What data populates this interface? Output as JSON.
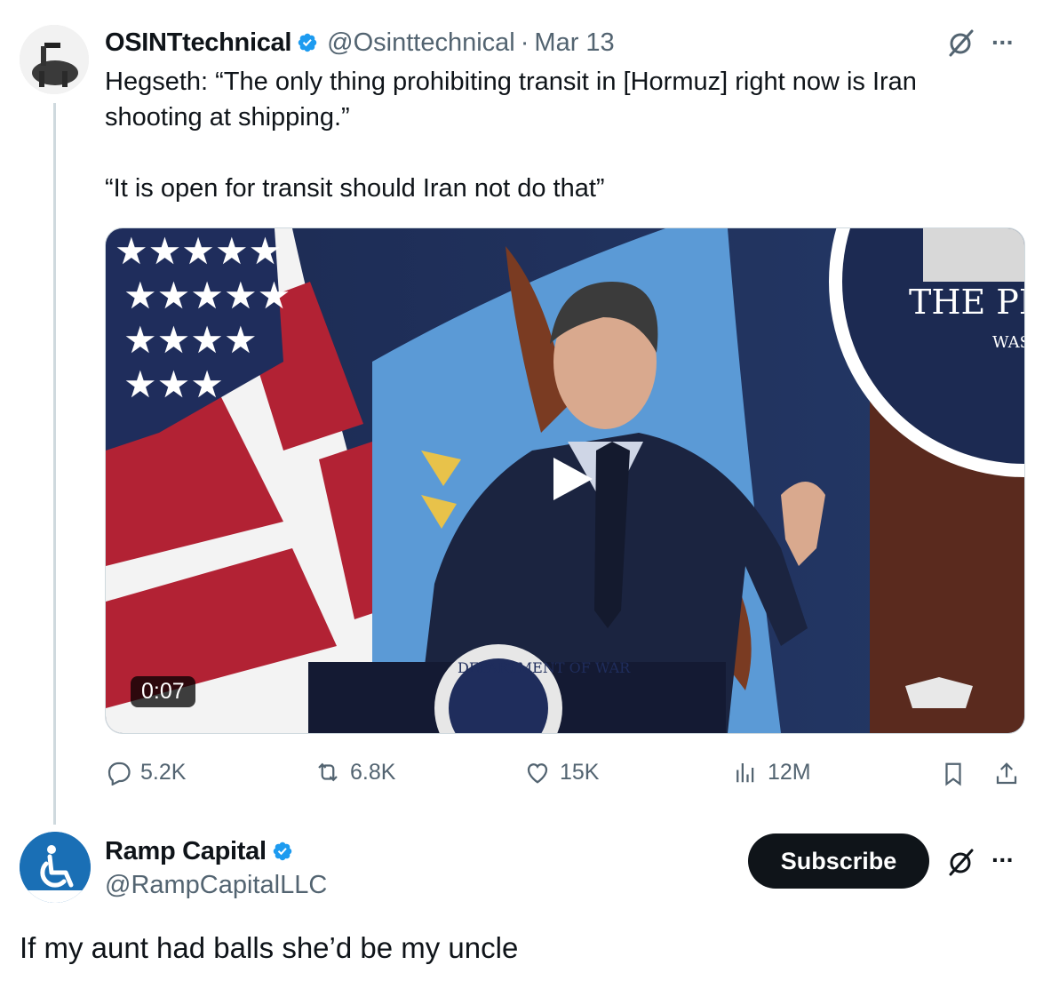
{
  "tweet": {
    "author_name": "OSINTtechnical",
    "author_handle": "@Osinttechnical",
    "separator": "·",
    "date": "Mar 13",
    "text_line1": "Hegseth: “The only thing prohibiting transit in [Hormuz] right now is Iran",
    "text_line2": "shooting at shipping.”",
    "text_line3": "“It is open for transit should Iran not do that”",
    "video_duration": "0:07",
    "video_seal_text": "THE PI",
    "video_seal_sub": "WAS",
    "podium_seal_text": "DEPARTMENT OF WAR",
    "more_label": "···",
    "actions": {
      "replies": "5.2K",
      "reposts": "6.8K",
      "likes": "15K",
      "views": "12M"
    }
  },
  "reply": {
    "author_name": "Ramp Capital",
    "author_handle": "@RampCapitalLLC",
    "subscribe_label": "Subscribe",
    "more_label": "···",
    "text": "If my aunt had balls she’d be my uncle"
  },
  "colors": {
    "verified": "#1d9bf0",
    "text": "#0f1419",
    "muted": "#536471",
    "ramp_avatar": "#1a6fb5"
  },
  "icons": [
    "verified-icon",
    "grok-icon",
    "more-icon",
    "play-icon",
    "reply-icon",
    "repost-icon",
    "like-icon",
    "views-icon",
    "bookmark-icon",
    "share-icon",
    "accessibility-icon"
  ]
}
